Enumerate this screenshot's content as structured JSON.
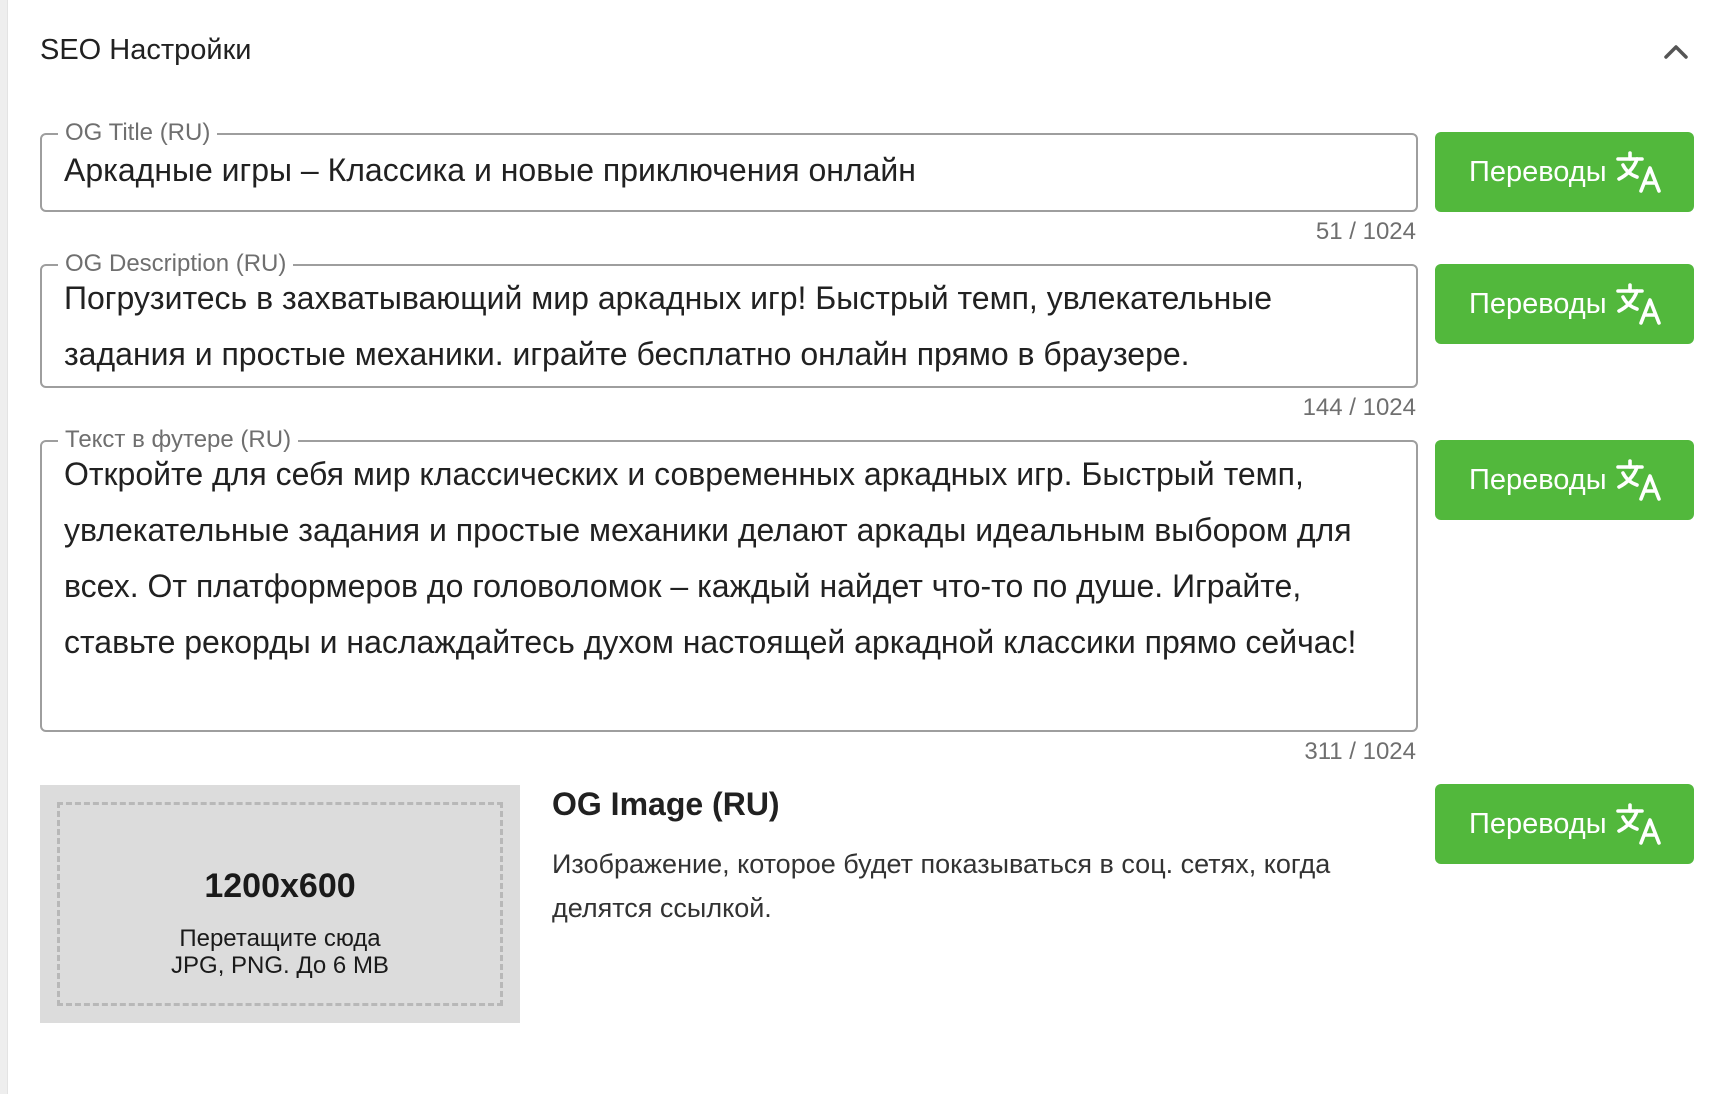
{
  "panel": {
    "title": "SEO Настройки",
    "collapse_icon": "chevron-up-icon"
  },
  "fields": {
    "og_title": {
      "label": "OG Title (RU)",
      "value": "Аркадные игры – Классика и новые приключения онлайн",
      "counter": "51 / 1024"
    },
    "og_description": {
      "label": "OG Description (RU)",
      "value": "Погрузитесь в захватывающий мир аркадных игр! Быстрый темп, увлекательные задания и простые механики. играйте бесплатно онлайн прямо в браузере.",
      "counter": "144 / 1024"
    },
    "footer_text": {
      "label": "Текст в футере (RU)",
      "value": "Откройте для себя мир классических и современных аркадных игр. Быстрый темп, увлекательные задания и простые механики делают аркады идеальным выбором для всех. От платформеров до головоломок – каждый найдет что-то по душе. Играйте, ставьте рекорды и наслаждайтесь духом настоящей аркадной классики прямо сейчас!",
      "counter": "311 / 1024"
    }
  },
  "og_image": {
    "title": "OG Image (RU)",
    "description": "Изображение, которое будет показываться в соц. сетях, когда делятся ссылкой.",
    "dropzone": {
      "size": "1200x600",
      "hint_line1": "Перетащите сюда",
      "hint_line2": "JPG, PNG. До 6 MB"
    }
  },
  "buttons": {
    "translate_label": "Переводы",
    "translate_icon": "translate-icon"
  },
  "colors": {
    "accent": "#52b83c",
    "border": "#9e9e9e",
    "muted_text": "#6f6f6f",
    "dropzone_bg": "#dcdcdc"
  }
}
